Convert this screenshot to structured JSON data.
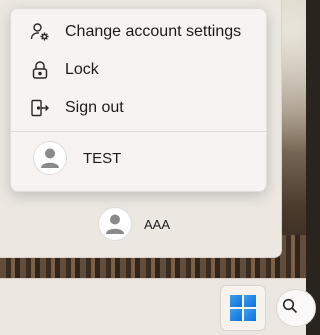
{
  "menu": {
    "items": [
      {
        "label": "Change account settings",
        "icon": "gear-person-icon"
      },
      {
        "label": "Lock",
        "icon": "lock-icon"
      },
      {
        "label": "Sign out",
        "icon": "sign-out-icon"
      }
    ],
    "switch_user": {
      "name": "TEST",
      "icon": "avatar-icon"
    }
  },
  "start_panel": {
    "current_user": {
      "name": "AAA",
      "icon": "avatar-icon"
    }
  },
  "taskbar": {
    "start_icon": "windows-logo-icon",
    "search_icon": "search-icon"
  },
  "colors": {
    "accent": "#1a78e0",
    "menu_bg": "#f6f3f0",
    "panel_bg": "#ece7e1",
    "text": "#1c1c1c"
  }
}
